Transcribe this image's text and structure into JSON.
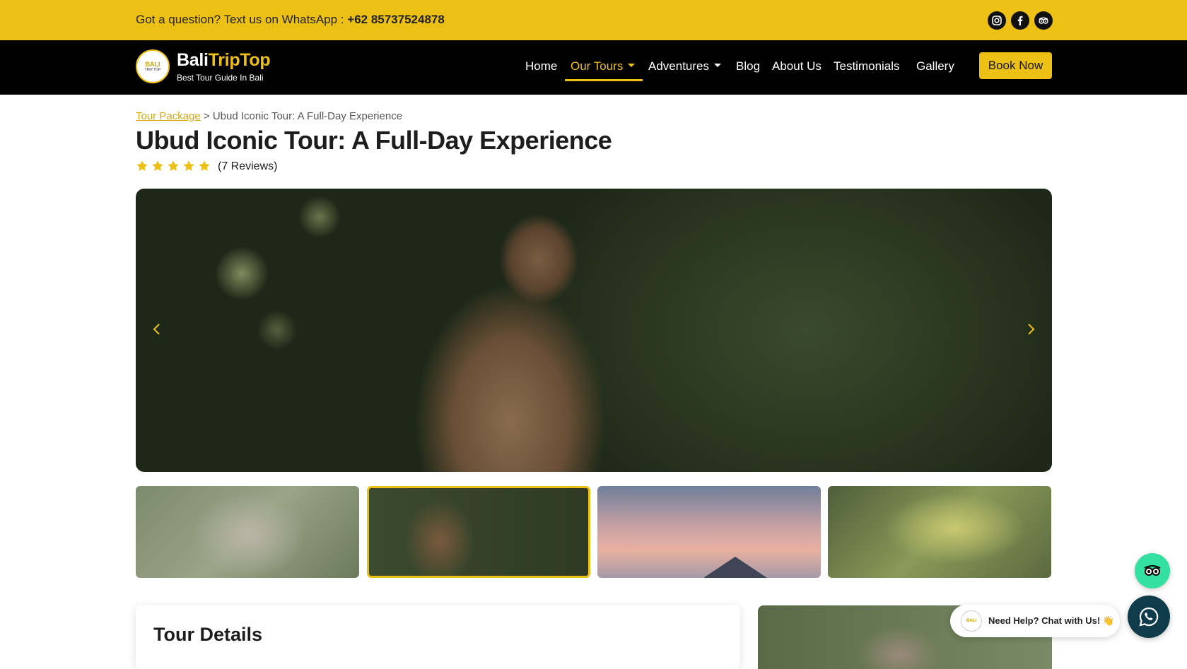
{
  "topbar": {
    "question": "Got a question? Text us on WhatsApp : ",
    "phone": "+62 85737524878",
    "social": [
      "instagram-icon",
      "facebook-icon",
      "tripadvisor-icon"
    ]
  },
  "brand": {
    "name_part1": "Bali",
    "name_part2": "TripTop",
    "tagline": "Best Tour Guide In Bali",
    "logo_text": "BALI",
    "logo_sub": "TRIP TOP"
  },
  "nav": {
    "items": [
      {
        "label": "Home"
      },
      {
        "label": "Our Tours",
        "active": true,
        "dropdown": true
      },
      {
        "label": "Adventures",
        "dropdown": true
      },
      {
        "label": "Blog"
      },
      {
        "label": "About Us"
      },
      {
        "label": "Testimonials"
      },
      {
        "label": "Gallery"
      }
    ],
    "cta": "Book Now"
  },
  "breadcrumb": {
    "link": "Tour Package",
    "separator": ">",
    "current": "Ubud Iconic Tour: A Full-Day Experience"
  },
  "tour": {
    "title": "Ubud Iconic Tour: A Full-Day Experience",
    "rating": 5,
    "reviews": "(7 Reviews)"
  },
  "gallery": {
    "selected_index": 1,
    "thumbnails": 4
  },
  "details": {
    "heading": "Tour Details"
  },
  "chat": {
    "text": "Need Help? Chat with Us! 👋"
  },
  "colors": {
    "accent": "#ecc014",
    "nav_bg": "#000000",
    "tripadvisor": "#34e0a1",
    "whatsapp_btn": "#0f3b4a"
  }
}
